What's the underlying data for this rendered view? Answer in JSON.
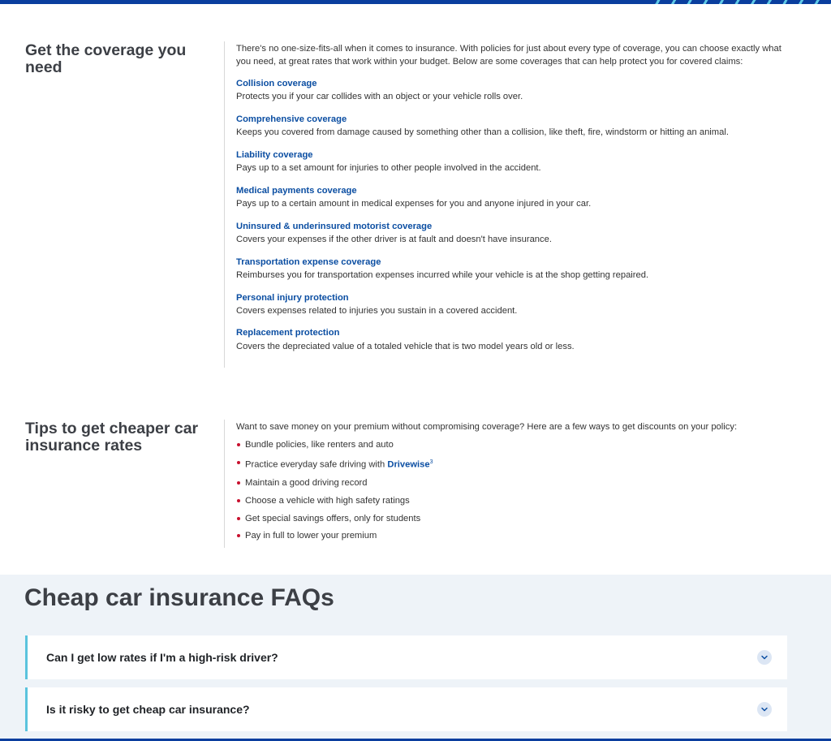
{
  "coverage": {
    "title": "Get the coverage you need",
    "intro": "There's no one-size-fits-all when it comes to insurance. With policies for just about every type of coverage, you can choose exactly what you need, at great rates that work within your budget. Below are some coverages that can help protect you for covered claims:",
    "items": [
      {
        "label": "Collision coverage",
        "desc": "Protects you if your car collides with an object or your vehicle rolls over."
      },
      {
        "label": "Comprehensive coverage",
        "desc": "Keeps you covered from damage caused by something other than a collision, like theft, fire, windstorm or hitting an animal."
      },
      {
        "label": "Liability coverage",
        "desc": "Pays up to a set amount for injuries to other people involved in the accident."
      },
      {
        "label": "Medical payments coverage",
        "desc": "Pays up to a certain amount in medical expenses for you and anyone injured in your car."
      },
      {
        "label": "Uninsured & underinsured motorist coverage",
        "desc": "Covers your expenses if the other driver is at fault and doesn't have insurance."
      },
      {
        "label": "Transportation expense coverage",
        "desc": "Reimburses you for transportation expenses incurred while your vehicle is at the shop getting repaired."
      },
      {
        "label": "Personal injury protection",
        "desc": "Covers expenses related to injuries you sustain in a covered accident."
      },
      {
        "label": "Replacement protection",
        "desc": "Covers the depreciated value of a totaled vehicle that is two model years old or less."
      }
    ]
  },
  "tips": {
    "title": "Tips to get cheaper car insurance rates",
    "intro": "Want to save money on your premium without compromising coverage? Here are a few ways to get discounts on your policy:",
    "items": [
      "Bundle policies, like renters and auto",
      "Practice everyday safe driving with ",
      "Maintain a good driving record",
      "Choose a vehicle with high safety ratings",
      "Get special savings offers, only for students",
      "Pay in full to lower your premium"
    ],
    "drivewise_link": "Drivewise",
    "drivewise_footnote": "3"
  },
  "faq": {
    "title": "Cheap car insurance FAQs",
    "questions": [
      "Can I get low rates if I'm a high-risk driver?",
      "Is it risky to get cheap car insurance?"
    ]
  },
  "icons": {
    "faq_toggle": "chevron-down-icon",
    "bullet": "red-dot-bullet"
  },
  "colors": {
    "link": "#0b4ea2",
    "bullet": "#c8102e",
    "faq_accent": "#5ac3dd",
    "brand_bar": "#0a3e9e"
  }
}
